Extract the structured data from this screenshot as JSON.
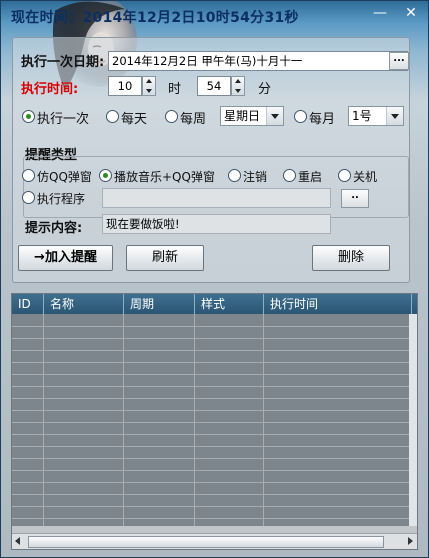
{
  "window": {
    "title": "现在时间：2014年12月2日10时54分31秒",
    "min_glyph": "—",
    "close_glyph": "✕"
  },
  "form": {
    "date_label": "执行一次日期:",
    "date_value": "2014年12月2日  甲午年(马)十月十一",
    "date_picker_label": "...",
    "time_label": "执行时间:",
    "hour_value": "10",
    "hour_unit": "时",
    "minute_value": "54",
    "minute_unit": "分"
  },
  "repeat": {
    "once": "执行一次",
    "daily": "每天",
    "weekly": "每周",
    "weekday_value": "星期日",
    "monthly": "每月",
    "monthday_value": "1号",
    "selected": "once"
  },
  "reminder": {
    "group_title": "提醒类型",
    "qq_popup": "仿QQ弹窗",
    "music_qq": "播放音乐+QQ弹窗",
    "logoff": "注销",
    "restart": "重启",
    "shutdown": "关机",
    "run_program": "执行程序",
    "program_value": "",
    "browse_label": "..",
    "selected": "music_qq"
  },
  "prompt": {
    "label": "提示内容:",
    "value": "现在要做饭啦!"
  },
  "buttons": {
    "add": "→加入提醒",
    "refresh": "刷新",
    "delete": "删除"
  },
  "table": {
    "columns": [
      "ID",
      "名称",
      "周期",
      "样式",
      "执行时间"
    ],
    "rows": []
  },
  "colors": {
    "title_text": "#0c2f63",
    "time_label": "#d80000",
    "radio_dot": "#2a8f1f",
    "grid_header": "#2b5674",
    "grid_body": "#7e868d"
  }
}
